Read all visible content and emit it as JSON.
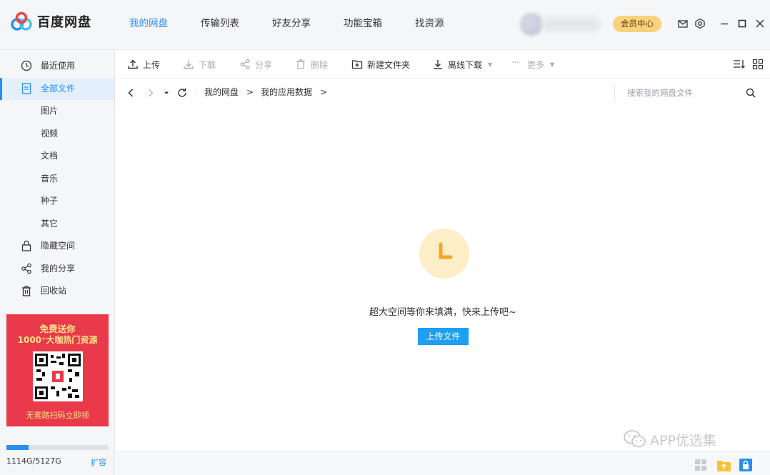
{
  "app": {
    "name": "百度网盘",
    "brand_color": "#2a8ef0",
    "accent_vip": "#f8d27c"
  },
  "nav": {
    "tabs": [
      {
        "label": "我的网盘",
        "active": true
      },
      {
        "label": "传输列表"
      },
      {
        "label": "好友分享"
      },
      {
        "label": "功能宝箱"
      },
      {
        "label": "找资源"
      }
    ]
  },
  "header": {
    "vip_label": "会员中心",
    "icons": [
      "mail-icon",
      "settings-icon",
      "minimize-icon",
      "maximize-icon",
      "close-icon"
    ]
  },
  "sidebar": {
    "items": [
      {
        "label": "最近使用",
        "icon": "clock-icon"
      },
      {
        "label": "全部文件",
        "icon": "file-icon",
        "active": true
      },
      {
        "label": "图片"
      },
      {
        "label": "视频"
      },
      {
        "label": "文档"
      },
      {
        "label": "音乐"
      },
      {
        "label": "种子"
      },
      {
        "label": "其它"
      },
      {
        "label": "隐藏空间",
        "icon": "lock-icon"
      },
      {
        "label": "我的分享",
        "icon": "share-icon"
      },
      {
        "label": "回收站",
        "icon": "trash-icon"
      }
    ],
    "promo": {
      "line1": "免费送你",
      "line2": "1000⁺大咖热门资源",
      "line3": "无套路扫码立即领",
      "bg_color": "#e9394a"
    },
    "quota": {
      "text": "1114G/5127G",
      "used_fraction": 0.217,
      "expand_label": "扩容"
    }
  },
  "toolbar": {
    "upload": "上传",
    "download": "下载",
    "share": "分享",
    "delete": "删除",
    "new_folder": "新建文件夹",
    "offline_download": "离线下载",
    "more": "更多"
  },
  "address": {
    "breadcrumbs": [
      "我的网盘",
      "我的应用数据"
    ],
    "search_placeholder": "搜索我的网盘文件"
  },
  "main": {
    "empty_message": "超大空间等你来填满，快来上传吧~",
    "upload_button": "上传文件"
  },
  "watermark": {
    "text": "APP优选集"
  }
}
